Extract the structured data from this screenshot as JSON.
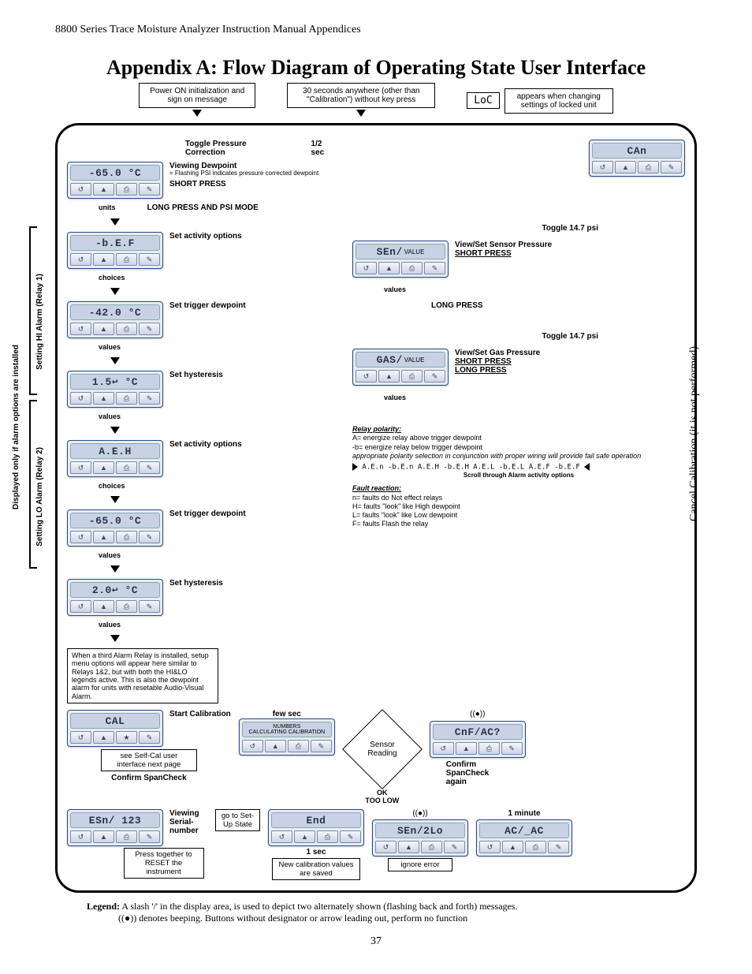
{
  "doc": {
    "running": "8800 Series Trace Moisture Analyzer Instruction Manual Appendices",
    "title": "Appendix A: Flow Diagram of Operating State User Interface",
    "page": "37"
  },
  "top": {
    "box1": "Power  ON initialization and sign on message",
    "box2": "30 seconds anywhere (other than \"Calibration\") without key press",
    "loc": "LoC",
    "box3": "appears when changing settings of locked unit"
  },
  "buttons": {
    "a": "↺",
    "b": "▲",
    "c": "⎙",
    "d": "✎"
  },
  "left": {
    "toggle": "Toggle Pressure Correction",
    "half_sec": "1/2 sec",
    "dev0": "-65.0 °C",
    "lbl0": "Viewing Dewpoint",
    "psi_note": "= Flashing PSI indicates pressure corrected dewpoint",
    "short": "SHORT PRESS",
    "long": "LONG PRESS AND PSI MODE",
    "units": "units",
    "dev1": "-b.E.F",
    "lbl1": "Set activity options",
    "choices": "choices",
    "dev2": "-42.0 °C",
    "lbl2": "Set trigger dewpoint",
    "values": "values",
    "dev3": "1.5↩ °C",
    "lbl3": "Set hysteresis",
    "dev4": "A.E.H",
    "lbl4": "Set activity options",
    "dev5": "-65.0 °C",
    "lbl5": "Set trigger dewpoint",
    "dev6": "2.0↩ °C",
    "lbl6": "Set hysteresis",
    "vlabel1": "Setting HI Alarm (Relay 1)",
    "vlabel2": "Setting LO Alarm (Relay 2)",
    "vlabel3": "Displayed only if alarm options are installed",
    "thirdnote": "When a third Alarm Relay is installed, setup menu options will appear here similar to Relays 1&2, but with both the HI&LO legends active. This is also the dewpoint alarm for units with resetable Audio-Visual Alarm."
  },
  "right": {
    "dev_can": "CAn",
    "toggle14_1": "Toggle 14.7 psi",
    "dev_sen": "SEn/",
    "sen_val": "VALUE",
    "sen_lbl": "View/Set Sensor Pressure",
    "short": "SHORT PRESS",
    "long": "LONG PRESS",
    "values": "values",
    "toggle14_2": "Toggle 14.7 psi",
    "dev_gas": "GAS/",
    "gas_val": "VALUE",
    "gas_lbl": "View/Set Gas Pressure",
    "relay_title": "Relay polarity:",
    "relay_a": "A= energize relay above trigger dewpoint",
    "relay_b": "-b= energize relay below trigger dewpoint",
    "relay_note": "appropriate polarity selection in conjunction with proper wiring will provide fail safe operation",
    "scroll": "A.E.n  -b.E.n  A.E.H  -b.E.H  A.E.L  -b.E.L  A.E.F  -b.E.F",
    "scroll_lbl": "Scroll through Alarm  activity options",
    "fault_title": "Fault reaction:",
    "fault_n": "n= faults do Not effect relays",
    "fault_h": "H= faults \"look\" like High dewpoint",
    "fault_l": "L= faults \"look\" like Low dewpoint",
    "fault_f": "F= faults Flash the relay",
    "cancel": "Cancel Calibration (it is not performed)"
  },
  "bottom": {
    "dev_cal": "CAL",
    "cal_lbl": "Start Calibration",
    "few": "few sec",
    "selfcal": "see Self-Cal user interface next page",
    "confirm": "Confirm SpanCheck",
    "dev_num": "NUMBERS",
    "num_sub": "CALCULATING CALIBRATION",
    "diamond": "Sensor Reading",
    "ok": "OK",
    "toolow": "TOO LOW",
    "dev_cnf": "CnF/AC?",
    "confirm2": "Confirm SpanCheck again",
    "dev_esn": "ESn/ 123",
    "esn_lbl": "Viewing Serial- number",
    "goto": "go to Set-Up State",
    "dev_end": "End",
    "onesec": "1 sec",
    "endnote": "New calibration values are saved",
    "dev_slo": "SEn/2Lo",
    "slonote": "ignore error",
    "onemin": "1 minute",
    "dev_ac": "AC/_AC",
    "reset": "Press together to RESET the instrument",
    "beep": "((●))"
  },
  "legend": {
    "prefix": "Legend:",
    "line1": " A slash '/' in the display area, is used to depict two alternately shown (flashing back and forth) messages.",
    "line2": " denotes beeping.  Buttons without designator or arrow leading out, perform no function",
    "beep": "((●))"
  }
}
